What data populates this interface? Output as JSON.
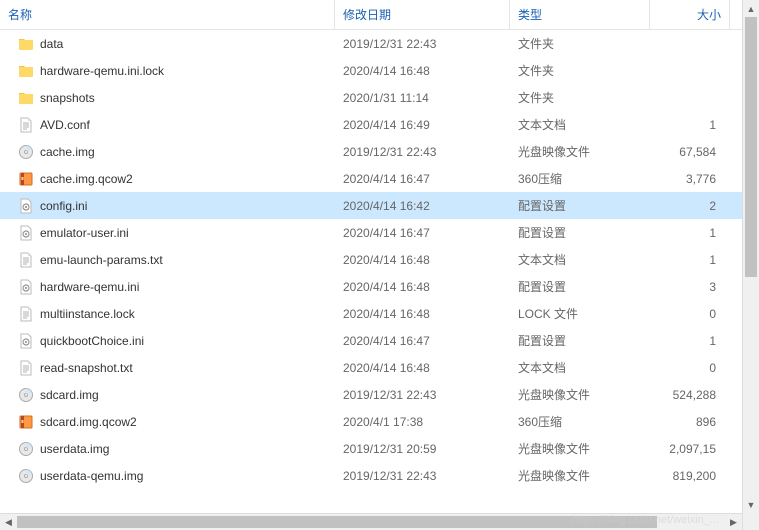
{
  "header": {
    "name": "名称",
    "date": "修改日期",
    "type": "类型",
    "size": "大小"
  },
  "files": [
    {
      "icon": "folder",
      "name": "data",
      "date": "2019/12/31 22:43",
      "type": "文件夹",
      "size": "",
      "selected": false
    },
    {
      "icon": "folder",
      "name": "hardware-qemu.ini.lock",
      "date": "2020/4/14 16:48",
      "type": "文件夹",
      "size": "",
      "selected": false
    },
    {
      "icon": "folder",
      "name": "snapshots",
      "date": "2020/1/31 11:14",
      "type": "文件夹",
      "size": "",
      "selected": false
    },
    {
      "icon": "text",
      "name": "AVD.conf",
      "date": "2020/4/14 16:49",
      "type": "文本文档",
      "size": "1",
      "selected": false
    },
    {
      "icon": "disc",
      "name": "cache.img",
      "date": "2019/12/31 22:43",
      "type": "光盘映像文件",
      "size": "67,584",
      "selected": false
    },
    {
      "icon": "archive",
      "name": "cache.img.qcow2",
      "date": "2020/4/14 16:47",
      "type": "360压缩",
      "size": "3,776",
      "selected": false
    },
    {
      "icon": "ini",
      "name": "config.ini",
      "date": "2020/4/14 16:42",
      "type": "配置设置",
      "size": "2",
      "selected": true
    },
    {
      "icon": "ini",
      "name": "emulator-user.ini",
      "date": "2020/4/14 16:47",
      "type": "配置设置",
      "size": "1",
      "selected": false
    },
    {
      "icon": "text",
      "name": "emu-launch-params.txt",
      "date": "2020/4/14 16:48",
      "type": "文本文档",
      "size": "1",
      "selected": false
    },
    {
      "icon": "ini",
      "name": "hardware-qemu.ini",
      "date": "2020/4/14 16:48",
      "type": "配置设置",
      "size": "3",
      "selected": false
    },
    {
      "icon": "text",
      "name": "multiinstance.lock",
      "date": "2020/4/14 16:48",
      "type": "LOCK 文件",
      "size": "0",
      "selected": false
    },
    {
      "icon": "ini",
      "name": "quickbootChoice.ini",
      "date": "2020/4/14 16:47",
      "type": "配置设置",
      "size": "1",
      "selected": false
    },
    {
      "icon": "text",
      "name": "read-snapshot.txt",
      "date": "2020/4/14 16:48",
      "type": "文本文档",
      "size": "0",
      "selected": false
    },
    {
      "icon": "disc",
      "name": "sdcard.img",
      "date": "2019/12/31 22:43",
      "type": "光盘映像文件",
      "size": "524,288",
      "selected": false
    },
    {
      "icon": "archive",
      "name": "sdcard.img.qcow2",
      "date": "2020/4/1 17:38",
      "type": "360压缩",
      "size": "896",
      "selected": false
    },
    {
      "icon": "disc",
      "name": "userdata.img",
      "date": "2019/12/31 20:59",
      "type": "光盘映像文件",
      "size": "2,097,15",
      "selected": false
    },
    {
      "icon": "disc",
      "name": "userdata-qemu.img",
      "date": "2019/12/31 22:43",
      "type": "光盘映像文件",
      "size": "819,200",
      "selected": false
    }
  ],
  "watermark": "https://blog.csdn.net/weixin_..."
}
